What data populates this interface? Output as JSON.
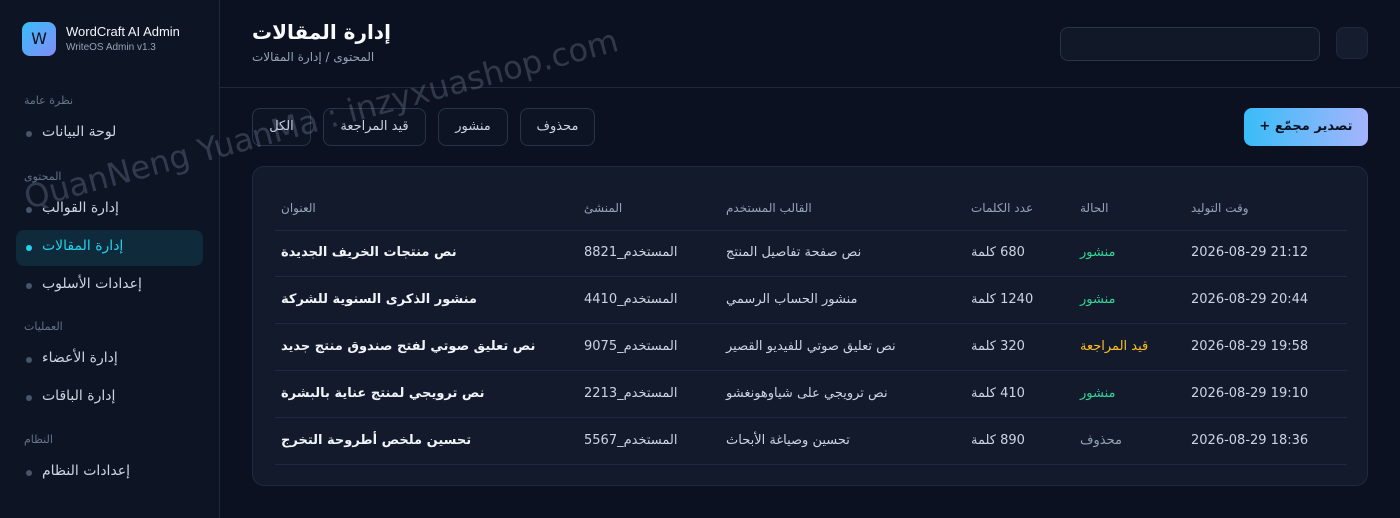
{
  "brand": {
    "logo": "W",
    "name": "WordCraft AI Admin",
    "version": "WriteOS Admin v1.3"
  },
  "sidebar": {
    "groups": [
      {
        "label": "نظرة عامة",
        "items": [
          {
            "label": "لوحة البيانات"
          }
        ]
      },
      {
        "label": "المحتوى",
        "items": [
          {
            "label": "إدارة القوالب"
          },
          {
            "label": "إدارة المقالات"
          },
          {
            "label": "إعدادات الأسلوب"
          }
        ]
      },
      {
        "label": "العمليات",
        "items": [
          {
            "label": "إدارة الأعضاء"
          },
          {
            "label": "إدارة الباقات"
          }
        ]
      },
      {
        "label": "النظام",
        "items": [
          {
            "label": "إعدادات النظام"
          }
        ]
      }
    ],
    "active": "إدارة المقالات"
  },
  "header": {
    "title": "إدارة المقالات",
    "breadcrumb": "المحتوى / إدارة المقالات",
    "search_value": ""
  },
  "filters": [
    "الكل",
    "قيد المراجعة",
    "منشور",
    "محذوف"
  ],
  "export_label": "تصدير مجمّع +",
  "table": {
    "columns": [
      "العنوان",
      "المنشئ",
      "القالب المستخدم",
      "عدد الكلمات",
      "الحالة",
      "وقت التوليد"
    ],
    "rows": [
      [
        "نص منتجات الخريف الجديدة",
        "المستخدم_8821",
        "نص صفحة تفاصيل المنتج",
        "680 كلمة",
        "منشور",
        "2026-08-29 21:12"
      ],
      [
        "منشور الذكرى السنوية للشركة",
        "المستخدم_4410",
        "منشور الحساب الرسمي",
        "1240 كلمة",
        "منشور",
        "2026-08-29 20:44"
      ],
      [
        "نص تعليق صوتي لفتح صندوق منتج جديد",
        "المستخدم_9075",
        "نص تعليق صوتي للفيديو القصير",
        "320 كلمة",
        "قيد المراجعة",
        "2026-08-29 19:58"
      ],
      [
        "نص ترويجي لمنتج عناية بالبشرة",
        "المستخدم_2213",
        "نص ترويجي على شياوهونغشو",
        "410 كلمة",
        "منشور",
        "2026-08-29 19:10"
      ],
      [
        "تحسين ملخص أطروحة التخرج",
        "المستخدم_5567",
        "تحسين وصياغة الأبحاث",
        "890 كلمة",
        "محذوف",
        "2026-08-29 18:36"
      ]
    ]
  },
  "status_colors": {
    "منشور": "#34d399",
    "قيد المراجعة": "#fbbf24",
    "محذوف": "#94a3b8"
  },
  "watermark": "QuanNeng YuanMa : inzyxuashop.com"
}
